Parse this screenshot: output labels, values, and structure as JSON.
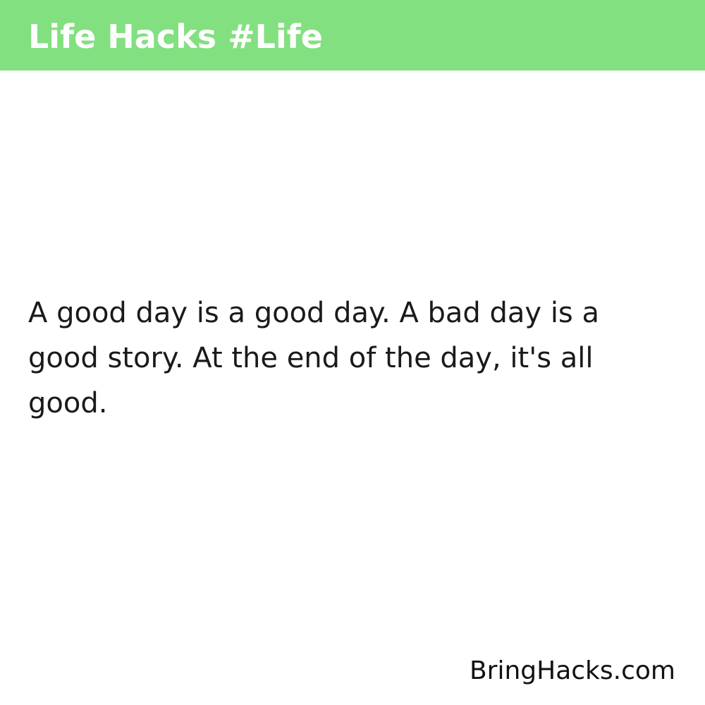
{
  "header": {
    "title": "Life Hacks #Life",
    "background_color": "#82e080"
  },
  "quote": {
    "text": "A good day is a good day. A bad day is a good story. At the end of the day, it's all good."
  },
  "footer": {
    "site": "BringHacks.com"
  }
}
